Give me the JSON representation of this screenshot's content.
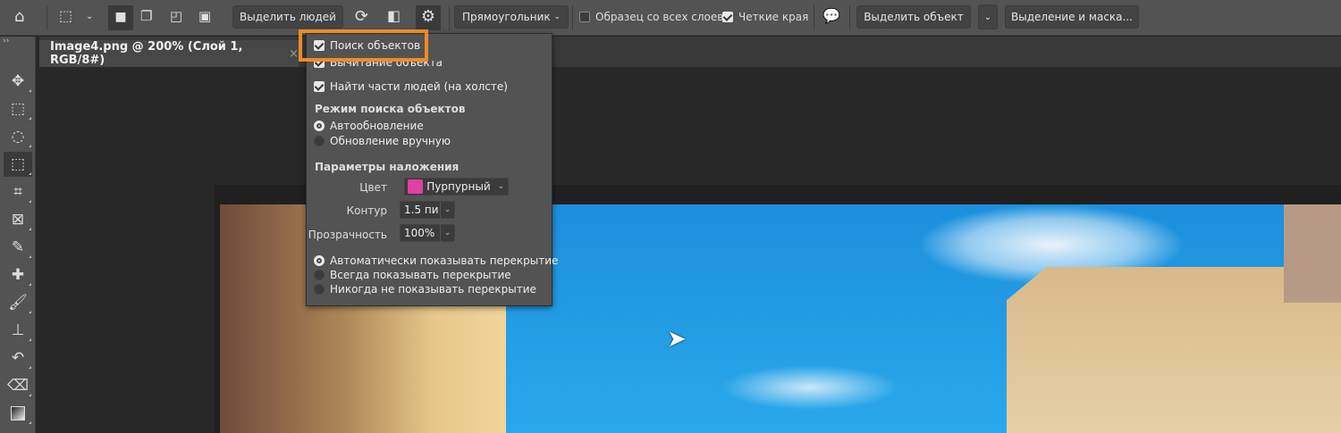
{
  "optionsbar": {
    "select_people": "Выделить людей",
    "mode_select": "Прямоугольник",
    "sample_all_layers": "Образец со всех слоев",
    "sample_all_layers_checked": false,
    "hard_edge": "Четкие края",
    "hard_edge_checked": true,
    "select_subject": "Выделить объект",
    "select_and_mask": "Выделение и маска..."
  },
  "document_tab": {
    "title": "Image4.png @ 200% (Слой 1, RGB/8#)",
    "close": "×"
  },
  "popup": {
    "object_finder": "Поиск объектов",
    "object_finder_checked": true,
    "object_subtract": "Вычитание объекта",
    "object_subtract_checked": true,
    "find_people_parts": "Найти части людей (на холсте)",
    "find_people_parts_checked": true,
    "mode_heading": "Режим поиска объектов",
    "mode_options": [
      {
        "label": "Автообновление",
        "selected": true
      },
      {
        "label": "Обновление вручную",
        "selected": false
      }
    ],
    "overlay_heading": "Параметры наложения",
    "color_label": "Цвет",
    "color_value": "Пурпурный",
    "color_swatch": "#e040a0",
    "outline_label": "Контур",
    "outline_value": "1.5 пи",
    "opacity_label": "Прозрачность",
    "opacity_value": "100%",
    "show_options": [
      {
        "label": "Автоматически показывать перекрытие",
        "selected": true
      },
      {
        "label": "Всегда показывать перекрытие",
        "selected": false
      },
      {
        "label": "Никогда не показывать перекрытие",
        "selected": false
      }
    ]
  },
  "colors": {
    "highlight": "#f08a24",
    "panel": "#535353"
  }
}
